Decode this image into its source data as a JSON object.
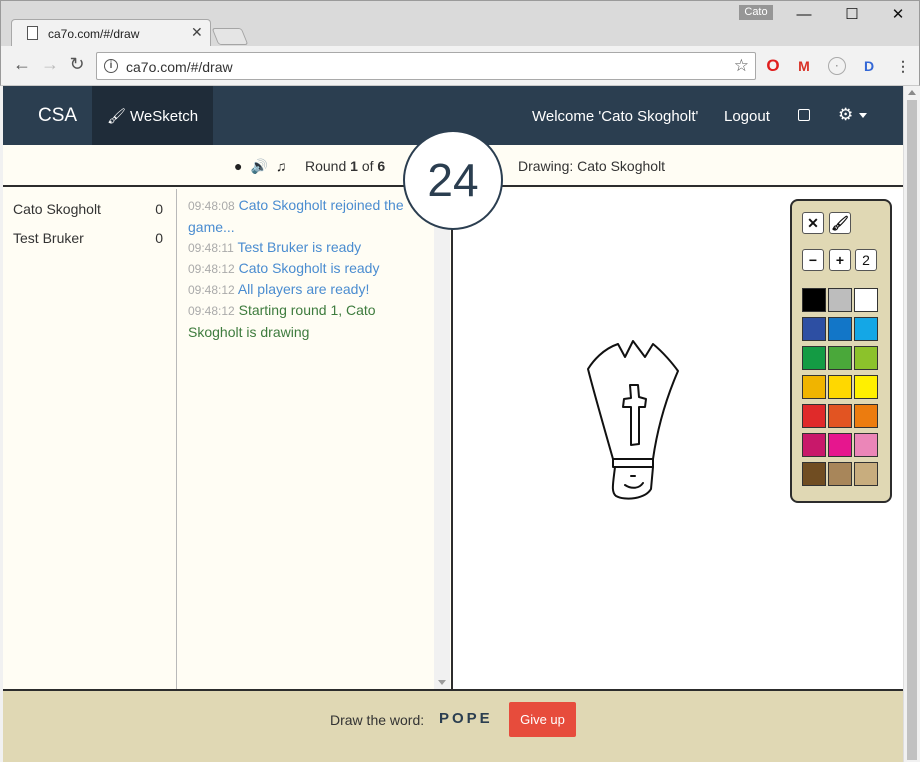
{
  "browser": {
    "tab_title": "ca7o.com/#/draw",
    "profile": "Cato",
    "url": "ca7o.com/#/draw",
    "window_buttons": {
      "minimize": "—",
      "maximize": "☐",
      "close": "✕"
    },
    "nav": {
      "back": "←",
      "forward": "→",
      "reload": "↻"
    },
    "extensions": [
      "opera-icon",
      "gmail-icon",
      "ext-circle-icon",
      "ext-d-icon"
    ]
  },
  "navbar": {
    "brand": "CSA",
    "active_item": "WeSketch",
    "welcome": "Welcome 'Cato Skogholt'",
    "logout": "Logout"
  },
  "infobar": {
    "round_prefix": "Round",
    "round_current": "1",
    "round_of": "of",
    "round_total": "6",
    "drawing": "Drawing: Cato Skogholt"
  },
  "timer": "24",
  "players": [
    {
      "name": "Cato Skogholt",
      "score": "0"
    },
    {
      "name": "Test Bruker",
      "score": "0"
    }
  ],
  "chat": [
    {
      "time": "09:48:08",
      "text": "Cato Skogholt rejoined the game...",
      "color": "blue"
    },
    {
      "time": "09:48:11",
      "text": "Test Bruker is ready",
      "color": "blue"
    },
    {
      "time": "09:48:12",
      "text": "Cato Skogholt is ready",
      "color": "blue"
    },
    {
      "time": "09:48:12",
      "text": "All players are ready!",
      "color": "blue"
    },
    {
      "time": "09:48:12",
      "text": "Starting round 1, Cato Skogholt is drawing",
      "color": "green"
    }
  ],
  "palette": {
    "brush_size": "2",
    "colors": [
      "#000000",
      "#bdbdbd",
      "#ffffff",
      "#2d4fa3",
      "#1276c8",
      "#14a7e6",
      "#149b44",
      "#4aa83a",
      "#8cc22b",
      "#f0b400",
      "#ffd800",
      "#fff000",
      "#e02a2a",
      "#e25422",
      "#ec7c0f",
      "#c8186a",
      "#e6168e",
      "#eb86b8",
      "#704d22",
      "#a8865a",
      "#c8ad7e"
    ]
  },
  "bottom": {
    "prompt": "Draw the word:",
    "word": "POPE",
    "give_up": "Give up"
  }
}
